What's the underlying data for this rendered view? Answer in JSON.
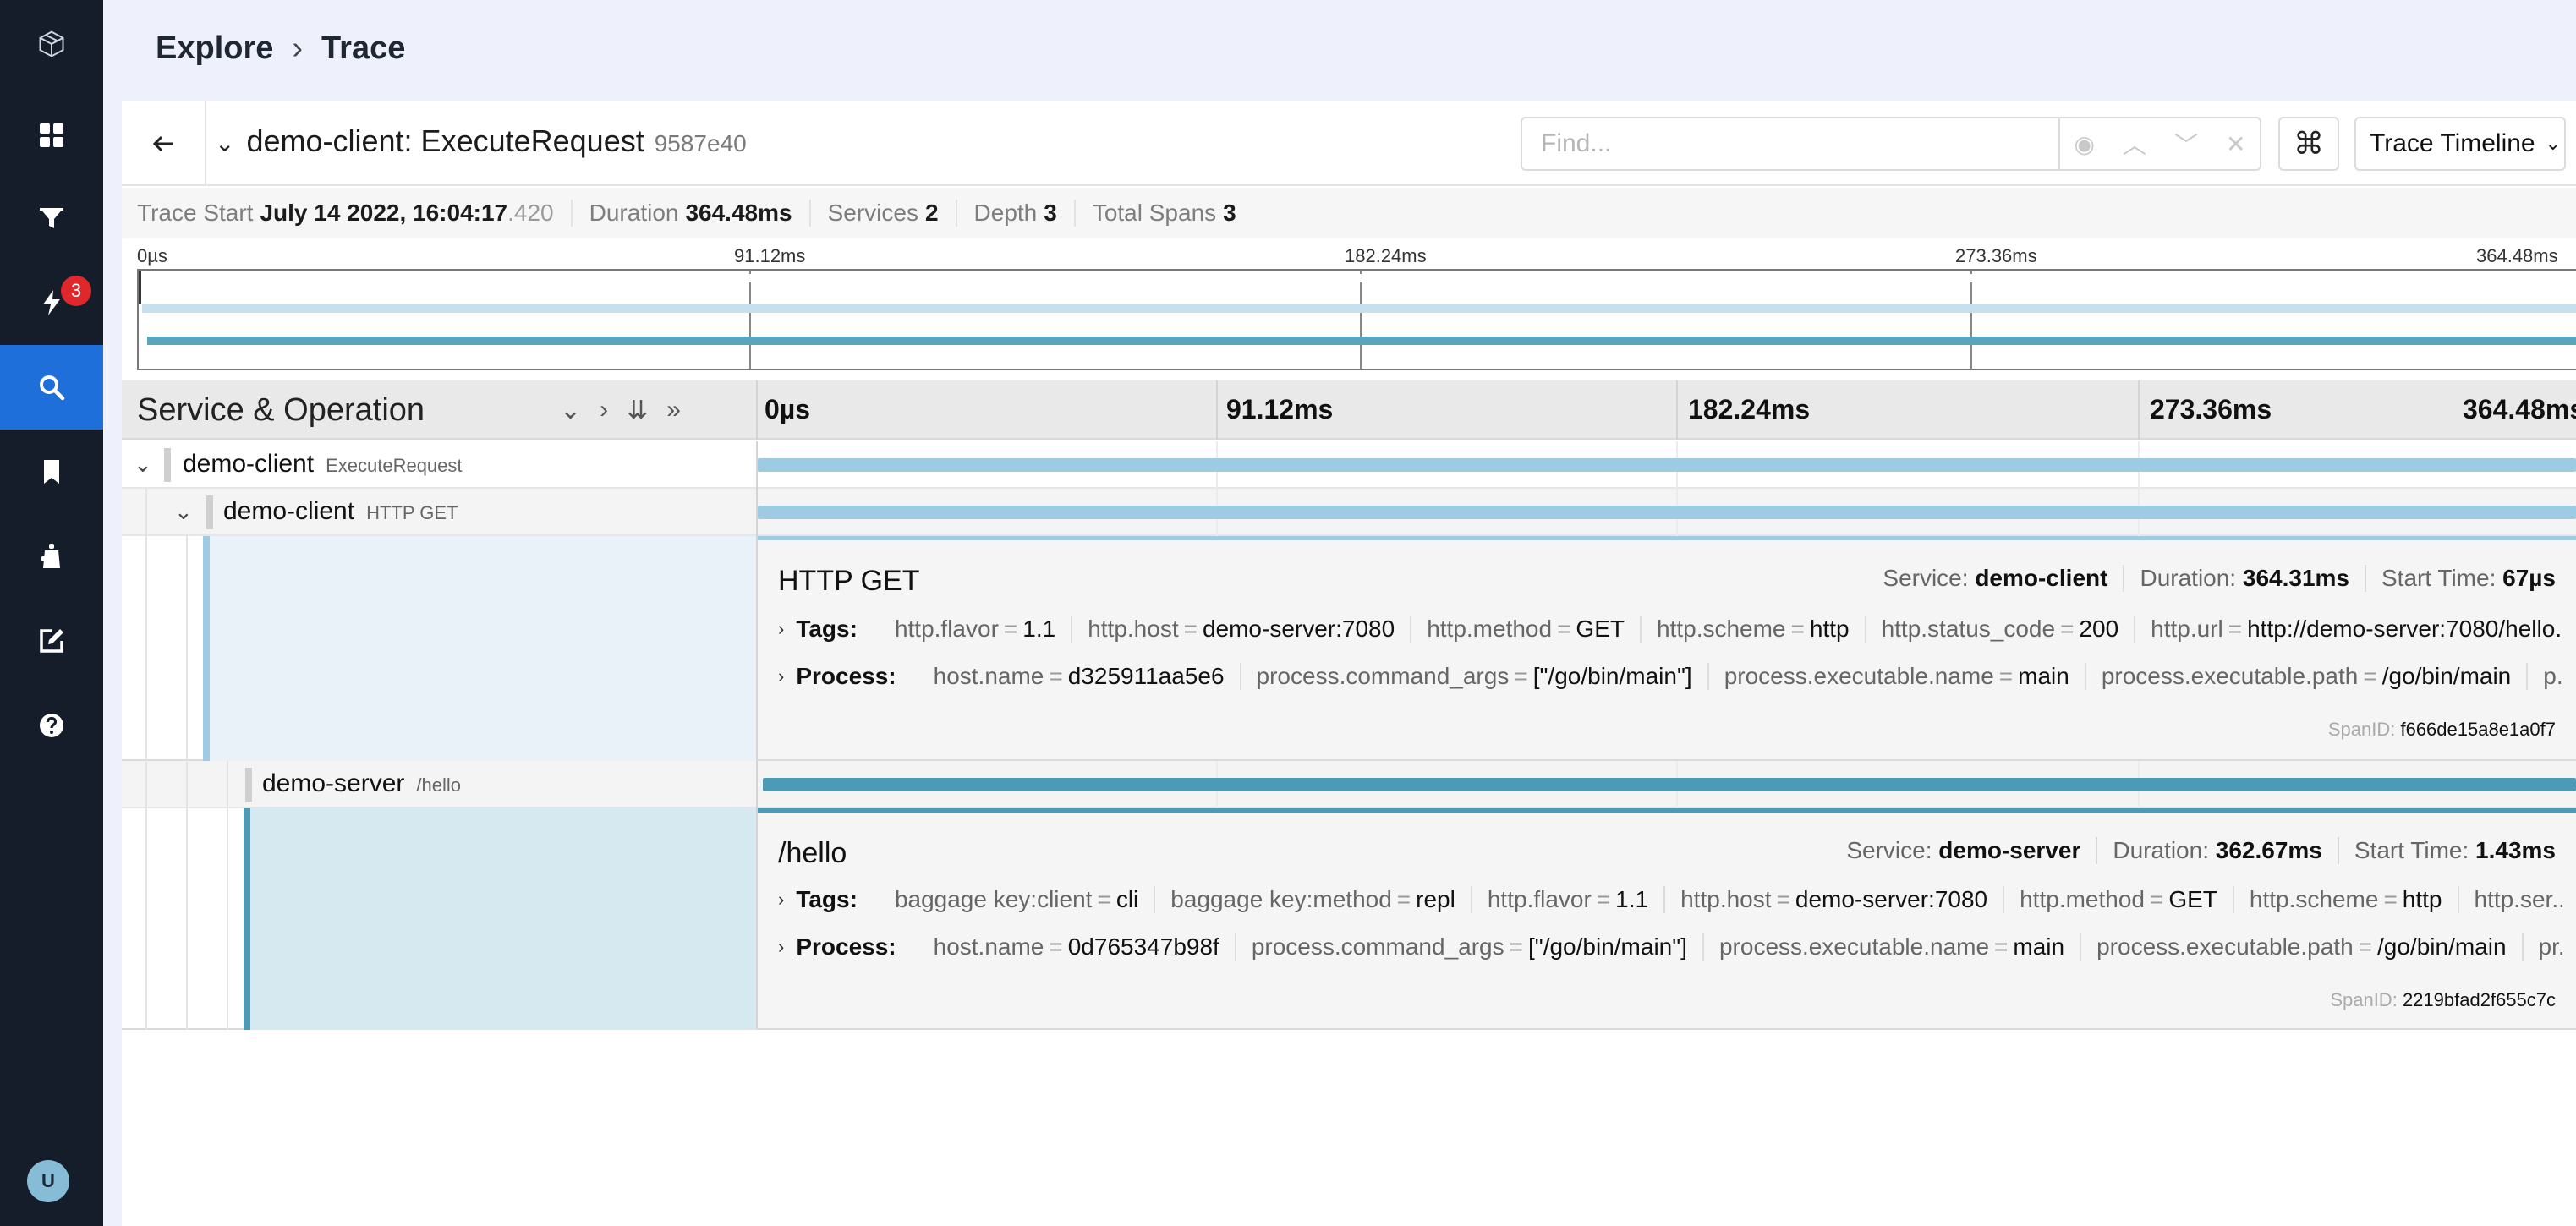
{
  "app": {
    "nav": {
      "alerts_badge": "3",
      "avatar_initial": "U"
    },
    "breadcrumb": [
      "Explore",
      "Trace"
    ]
  },
  "trace": {
    "service_operation": "demo-client: ExecuteRequest",
    "trace_id": "9587e40",
    "find_placeholder": "Find...",
    "view_select": "Trace Timeline",
    "meta": {
      "trace_start_label": "Trace Start",
      "trace_start_value": "July 14 2022, 16:04:17",
      "trace_start_ms": ".420",
      "duration_label": "Duration",
      "duration_value": "364.48ms",
      "services_label": "Services",
      "services_value": "2",
      "depth_label": "Depth",
      "depth_value": "3",
      "total_spans_label": "Total Spans",
      "total_spans_value": "3"
    },
    "minimap_ticks": [
      "0µs",
      "91.12ms",
      "182.24ms",
      "273.36ms",
      "364.48ms"
    ],
    "timeline_header": {
      "title": "Service & Operation",
      "ticks": [
        "0µs",
        "91.12ms",
        "182.24ms",
        "273.36ms",
        "364.48ms"
      ]
    },
    "colors": {
      "client": "#9dcbe3",
      "server": "#4d9ab6",
      "active": "#1e6fd9"
    },
    "spans": [
      {
        "service": "demo-client",
        "operation": "ExecuteRequest",
        "start_ms": 0,
        "duration_ms": 364.48
      },
      {
        "service": "demo-client",
        "operation": "HTTP GET",
        "start_ms": 0.067,
        "duration_ms": 364.31,
        "detail": {
          "op_name": "HTTP GET",
          "service_label": "Service:",
          "service_value": "demo-client",
          "duration_label": "Duration:",
          "duration_value": "364.31ms",
          "start_label": "Start Time:",
          "start_value": "67µs",
          "tags_label": "Tags:",
          "tags": [
            {
              "k": "http.flavor",
              "v": "1.1"
            },
            {
              "k": "http.host",
              "v": "demo-server:7080"
            },
            {
              "k": "http.method",
              "v": "GET"
            },
            {
              "k": "http.scheme",
              "v": "http"
            },
            {
              "k": "http.status_code",
              "v": "200"
            },
            {
              "k": "http.url",
              "v": "http://demo-server:7080/hello..."
            }
          ],
          "process_label": "Process:",
          "process": [
            {
              "k": "host.name",
              "v": "d325911aa5e6"
            },
            {
              "k": "process.command_args",
              "v": "[\"/go/bin/main\"]"
            },
            {
              "k": "process.executable.name",
              "v": "main"
            },
            {
              "k": "process.executable.path",
              "v": "/go/bin/main"
            },
            {
              "k": "p...",
              "v": ""
            }
          ],
          "span_id_label": "SpanID:",
          "span_id": "f666de15a8e1a0f7"
        }
      },
      {
        "service": "demo-server",
        "operation": "/hello",
        "start_ms": 1.43,
        "duration_ms": 362.67,
        "detail": {
          "op_name": "/hello",
          "service_label": "Service:",
          "service_value": "demo-server",
          "duration_label": "Duration:",
          "duration_value": "362.67ms",
          "start_label": "Start Time:",
          "start_value": "1.43ms",
          "tags_label": "Tags:",
          "tags": [
            {
              "k": "baggage key:client",
              "v": "cli"
            },
            {
              "k": "baggage key:method",
              "v": "repl"
            },
            {
              "k": "http.flavor",
              "v": "1.1"
            },
            {
              "k": "http.host",
              "v": "demo-server:7080"
            },
            {
              "k": "http.method",
              "v": "GET"
            },
            {
              "k": "http.scheme",
              "v": "http"
            },
            {
              "k": "http.ser...",
              "v": ""
            }
          ],
          "process_label": "Process:",
          "process": [
            {
              "k": "host.name",
              "v": "0d765347b98f"
            },
            {
              "k": "process.command_args",
              "v": "[\"/go/bin/main\"]"
            },
            {
              "k": "process.executable.name",
              "v": "main"
            },
            {
              "k": "process.executable.path",
              "v": "/go/bin/main"
            },
            {
              "k": "pr...",
              "v": ""
            }
          ],
          "span_id_label": "SpanID:",
          "span_id": "2219bfad2f655c7c"
        }
      }
    ]
  }
}
